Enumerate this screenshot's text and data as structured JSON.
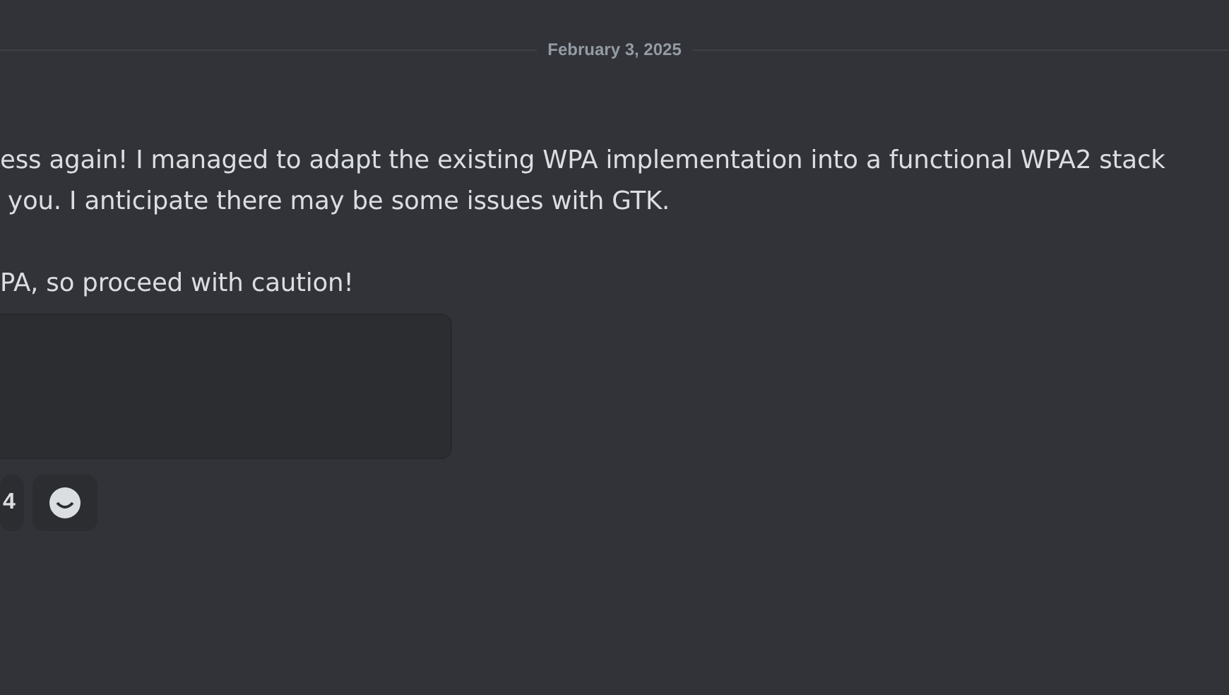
{
  "date_divider": "February 3, 2025",
  "message": {
    "paragraphs": [
      {
        "lines": [
          "ess again! I managed to adapt the existing WPA implementation into a functional WPA2 stack",
          " you. I anticipate there may be some issues with GTK."
        ]
      },
      {
        "lines": [
          "PA, so proceed with caution!"
        ]
      }
    ],
    "embed": {
      "kind": "blank"
    },
    "reactions": [
      {
        "count": "4"
      }
    ]
  }
}
